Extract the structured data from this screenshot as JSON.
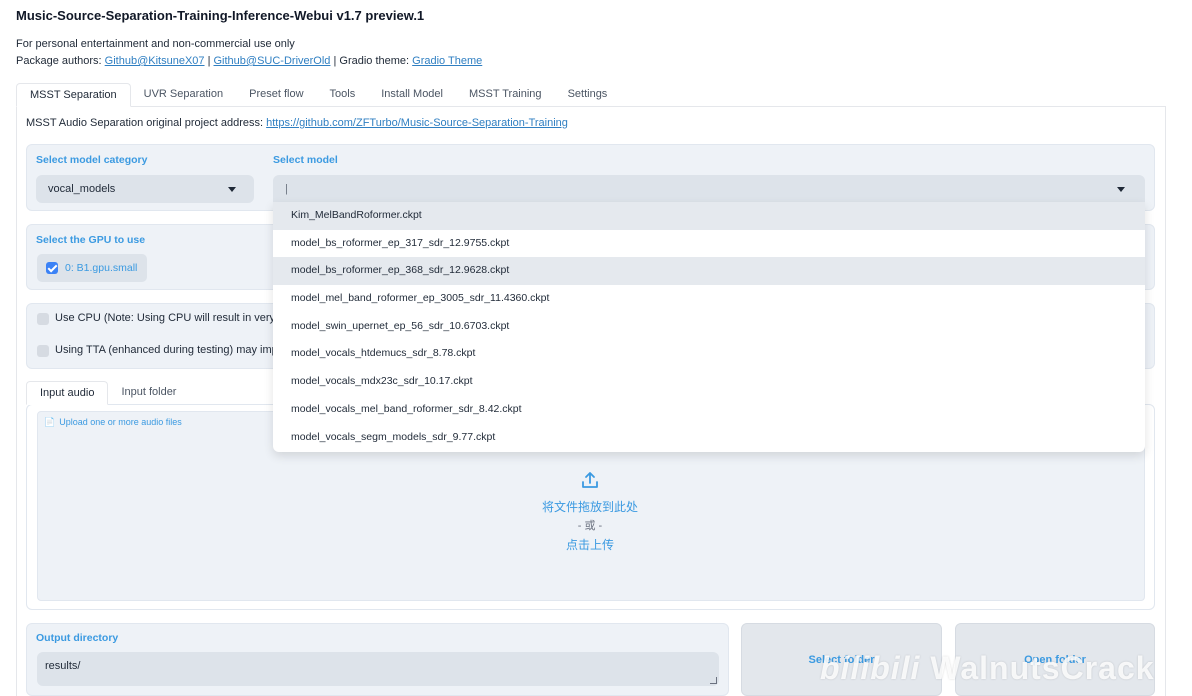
{
  "header": {
    "title": "Music-Source-Separation-Training-Inference-Webui v1.7 preview.1",
    "disclaimer": "For personal entertainment and non-commercial use only",
    "authors_prefix": "Package authors: ",
    "author1": "Github@KitsuneX07",
    "sep": " | ",
    "author2": "Github@SUC-DriverOld",
    "theme_prefix": " | Gradio theme: ",
    "theme_link": "Gradio Theme"
  },
  "tabs": [
    {
      "label": "MSST Separation"
    },
    {
      "label": "UVR Separation"
    },
    {
      "label": "Preset flow"
    },
    {
      "label": "Tools"
    },
    {
      "label": "Install Model"
    },
    {
      "label": "MSST Training"
    },
    {
      "label": "Settings"
    }
  ],
  "project": {
    "prefix": "MSST Audio Separation original project address: ",
    "url": "https://github.com/ZFTurbo/Music-Source-Separation-Training"
  },
  "model_category": {
    "label": "Select model category",
    "value": "vocal_models"
  },
  "model_select": {
    "label": "Select model",
    "value": "|",
    "options": [
      "Kim_MelBandRoformer.ckpt",
      "model_bs_roformer_ep_317_sdr_12.9755.ckpt",
      "model_bs_roformer_ep_368_sdr_12.9628.ckpt",
      "model_mel_band_roformer_ep_3005_sdr_11.4360.ckpt",
      "model_swin_upernet_ep_56_sdr_10.6703.ckpt",
      "model_vocals_htdemucs_sdr_8.78.ckpt",
      "model_vocals_mdx23c_sdr_10.17.ckpt",
      "model_vocals_mel_band_roformer_sdr_8.42.ckpt",
      "model_vocals_segm_models_sdr_9.77.ckpt"
    ]
  },
  "gpu": {
    "label": "Select the GPU to use",
    "option": "0: B1.gpu.small"
  },
  "options": {
    "use_cpu": "Use CPU (Note: Using CPU will result in very s",
    "use_tta": "Using TTA (enhanced during testing) may imp"
  },
  "input": {
    "tabs": [
      {
        "label": "Input audio"
      },
      {
        "label": "Input folder"
      }
    ],
    "upload_label": "Upload one or more audio files",
    "drop_text": "将文件拖放到此处",
    "or_text": "- 或 -",
    "click_text": "点击上传"
  },
  "output": {
    "label": "Output directory",
    "value": "results/"
  },
  "buttons": {
    "select_folder": "Select folder",
    "open_folder": "Open folder"
  },
  "watermark": {
    "logo": "bilibili",
    "name": "WalnutsCrack"
  },
  "colors": {
    "accent": "#3b9ae1",
    "panel": "#eef2f7",
    "field": "#dde3ea"
  }
}
